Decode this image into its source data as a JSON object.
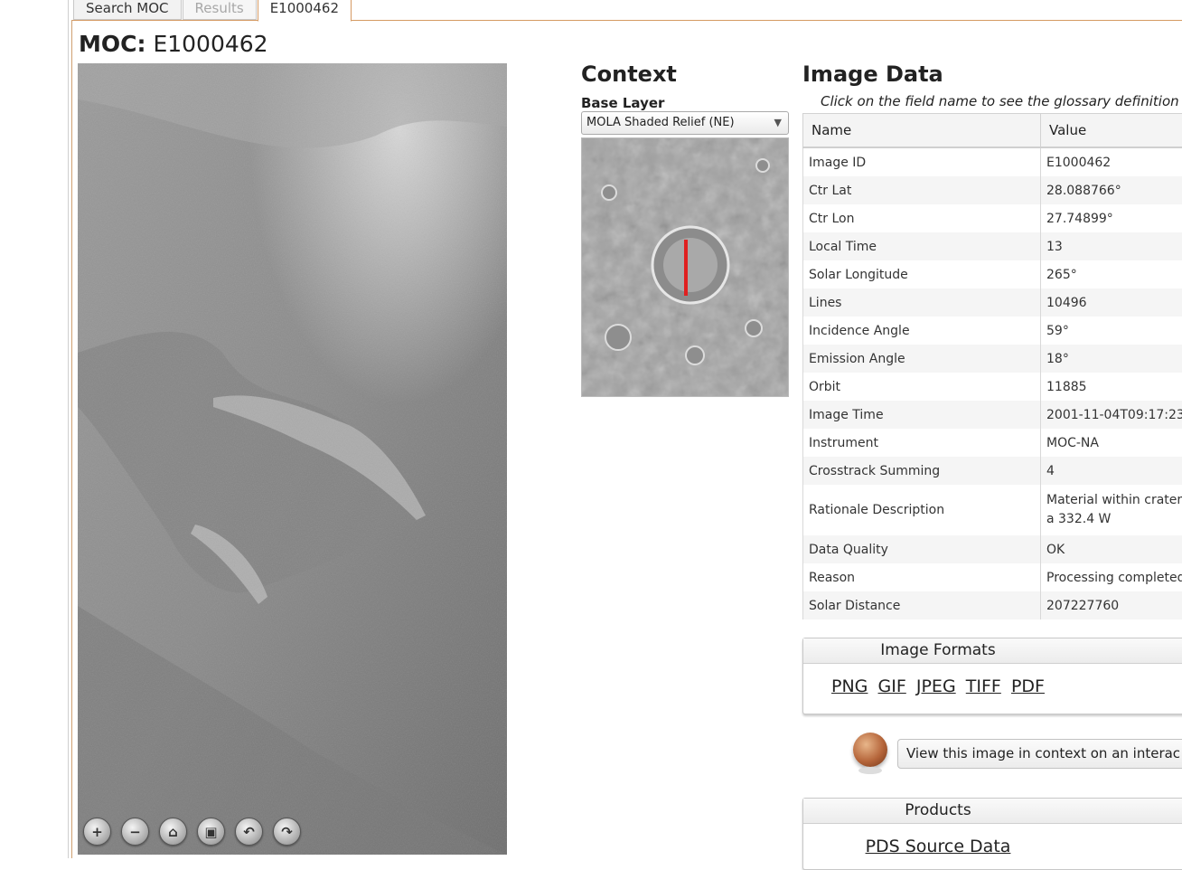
{
  "tabs": [
    {
      "label": "Search MOC",
      "state": "normal"
    },
    {
      "label": "Results",
      "state": "disabled"
    },
    {
      "label": "E1000462",
      "state": "active"
    }
  ],
  "page_title": {
    "prefix": "MOC:",
    "id": "E1000462"
  },
  "image_controls": [
    "zoom-in-icon",
    "zoom-out-icon",
    "home-icon",
    "fullscreen-icon",
    "rotate-left-icon",
    "rotate-right-icon"
  ],
  "context": {
    "title": "Context",
    "base_layer_label": "Base Layer",
    "base_layer_value": "MOLA Shaded Relief (NE)"
  },
  "image_data": {
    "title": "Image Data",
    "hint": "Click on the field name to see the glossary definition",
    "columns": [
      "Name",
      "Value"
    ],
    "rows": [
      {
        "name": "Image ID",
        "value": "E1000462"
      },
      {
        "name": "Ctr Lat",
        "value": "28.088766°"
      },
      {
        "name": "Ctr Lon",
        "value": "27.74899°"
      },
      {
        "name": "Local Time",
        "value": "13"
      },
      {
        "name": "Solar Longitude",
        "value": "265°"
      },
      {
        "name": "Lines",
        "value": "10496"
      },
      {
        "name": "Incidence Angle",
        "value": "59°"
      },
      {
        "name": "Emission Angle",
        "value": "18°"
      },
      {
        "name": "Orbit",
        "value": "11885"
      },
      {
        "name": "Image Time",
        "value": "2001-11-04T09:17:23"
      },
      {
        "name": "Instrument",
        "value": "MOC-NA"
      },
      {
        "name": "Crosstrack Summing",
        "value": "4"
      },
      {
        "name": "Rationale Description",
        "value": "Material within crater a 332.4 W"
      },
      {
        "name": "Data Quality",
        "value": "OK"
      },
      {
        "name": "Reason",
        "value": "Processing completed"
      },
      {
        "name": "Solar Distance",
        "value": "207227760"
      }
    ]
  },
  "image_formats": {
    "title": "Image Formats",
    "links": [
      "PNG",
      "GIF",
      "JPEG",
      "TIFF",
      "PDF"
    ]
  },
  "interactive_button": "View this image in context on an interac",
  "products": {
    "title": "Products",
    "link": "PDS Source Data"
  }
}
